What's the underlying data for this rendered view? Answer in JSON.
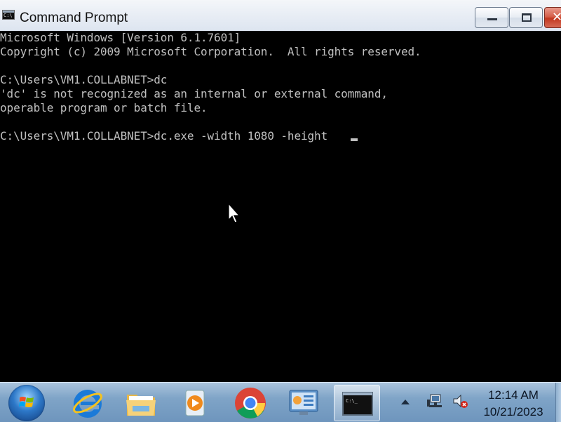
{
  "window": {
    "title": "Command Prompt",
    "minimize_label": "",
    "maximize_label": "",
    "close_glyph": "✕"
  },
  "console": {
    "lines": [
      "Microsoft Windows [Version 6.1.7601]",
      "Copyright (c) 2009 Microsoft Corporation.  All rights reserved.",
      "",
      "C:\\Users\\VM1.COLLABNET>dc",
      "'dc' is not recognized as an internal or external command,",
      "operable program or batch file.",
      "",
      "C:\\Users\\VM1.COLLABNET>dc.exe -width 1080 -height "
    ],
    "text_color": "#c0c0c0",
    "background": "#000000"
  },
  "taskbar": {
    "items": [
      {
        "name": "internet-explorer",
        "icon": "ie-icon"
      },
      {
        "name": "windows-explorer",
        "icon": "folder-icon"
      },
      {
        "name": "media-player",
        "icon": "media-player-icon"
      },
      {
        "name": "chrome",
        "icon": "chrome-icon"
      },
      {
        "name": "control-panel",
        "icon": "control-panel-icon"
      },
      {
        "name": "command-prompt",
        "icon": "cmd-icon",
        "active": true
      }
    ],
    "clock": {
      "time": "12:14 AM",
      "date": "10/21/2023"
    }
  }
}
